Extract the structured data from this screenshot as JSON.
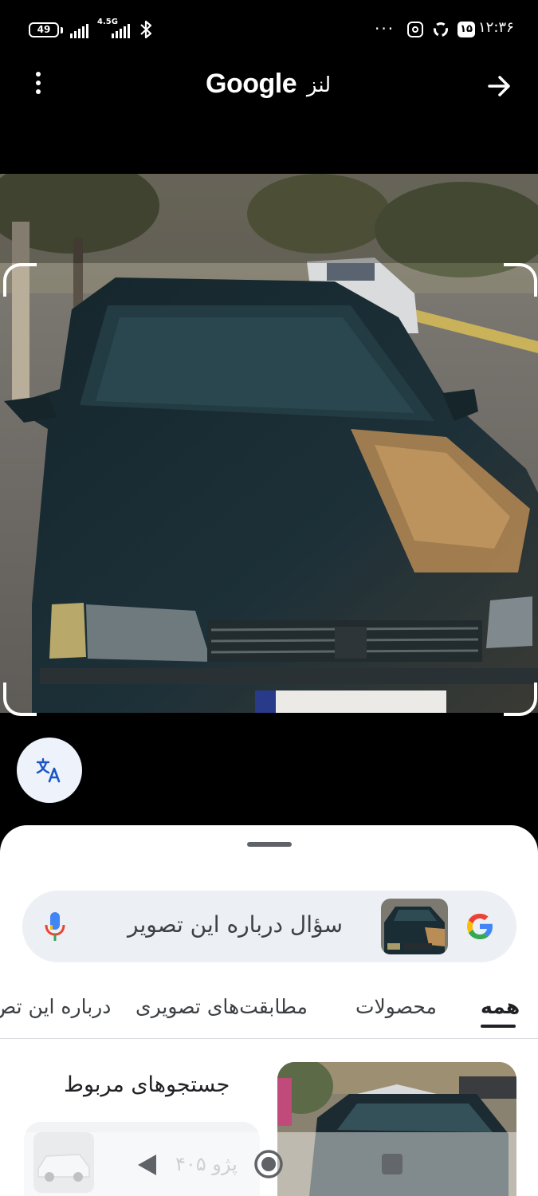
{
  "status_bar": {
    "battery": "49",
    "network": "4.5G",
    "time": "۱۲:۳۶",
    "notification_badge": "۱۵",
    "more": "···"
  },
  "app_bar": {
    "title_brand": "Google",
    "title_fa": "لنز"
  },
  "search": {
    "placeholder": "سؤال درباره این تصویر"
  },
  "tabs": [
    {
      "label": "همه",
      "active": true
    },
    {
      "label": "محصولات",
      "active": false
    },
    {
      "label": "مطابقت‌های تصویری",
      "active": false
    },
    {
      "label": "درباره این تص",
      "active": false
    }
  ],
  "related": {
    "title": "جستجوهای مربوط",
    "chip_label": "پژو ۴۰۵"
  },
  "colors": {
    "sheet_bg": "#ffffff",
    "search_bg": "#eceff3",
    "accent_blue": "#4285f4"
  }
}
